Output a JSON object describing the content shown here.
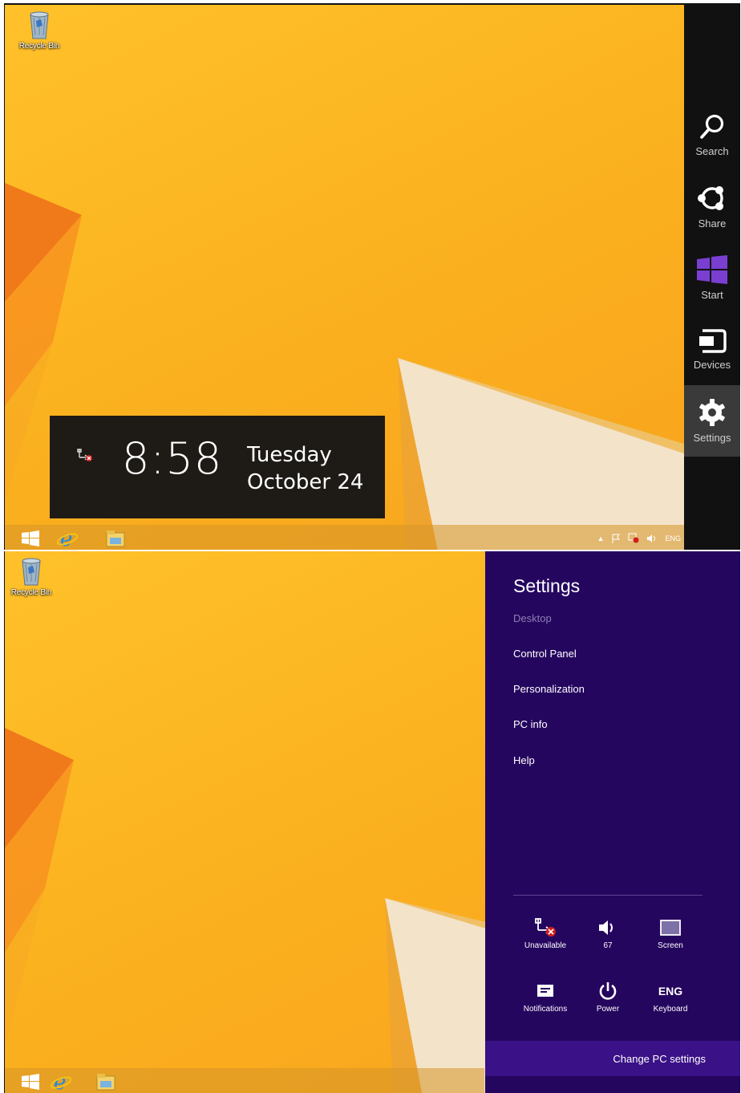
{
  "desktop": {
    "recycle_bin_label": "Recycle Bin"
  },
  "charms": {
    "items": [
      {
        "label": "Search",
        "icon": "search-icon"
      },
      {
        "label": "Share",
        "icon": "share-icon"
      },
      {
        "label": "Start",
        "icon": "windows-logo-icon"
      },
      {
        "label": "Devices",
        "icon": "devices-icon"
      },
      {
        "label": "Settings",
        "icon": "gear-icon"
      }
    ],
    "active": "Settings"
  },
  "clock": {
    "time": "8:58",
    "day": "Tuesday",
    "date": "October 24"
  },
  "taskbar": {
    "pinned": [
      "start-button",
      "internet-explorer-icon",
      "file-explorer-icon"
    ],
    "tray_language": "ENG"
  },
  "settings_pane": {
    "title": "Settings",
    "context": "Desktop",
    "links": [
      "Control Panel",
      "Personalization",
      "PC info",
      "Help"
    ],
    "quick_settings": [
      {
        "label": "Unavailable",
        "icon": "network-unavailable-icon"
      },
      {
        "label": "67",
        "icon": "volume-icon"
      },
      {
        "label": "Screen",
        "icon": "screen-icon"
      },
      {
        "label": "Notifications",
        "icon": "notifications-icon"
      },
      {
        "label": "Power",
        "icon": "power-icon"
      },
      {
        "label": "Keyboard",
        "icon": "keyboard-icon",
        "value": "ENG"
      }
    ],
    "change_pc_settings": "Change PC settings"
  },
  "colors": {
    "wallpaper": "#fbb31f",
    "charms_bg": "#111111",
    "pane_bg": "#25065f",
    "pane_bottom": "#3a1186",
    "start_tile": "#7a3ed1"
  }
}
